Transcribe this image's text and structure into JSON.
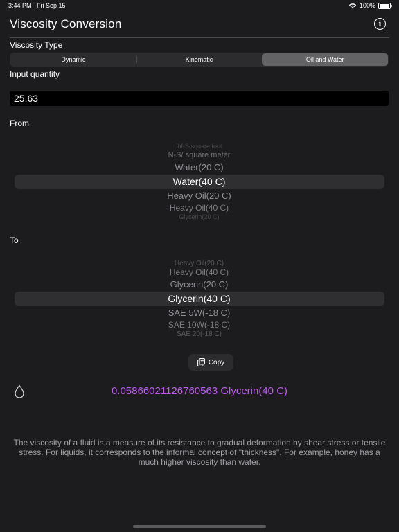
{
  "status_bar": {
    "time": "3:44 PM",
    "date": "Fri Sep 15",
    "battery": "100%",
    "wifi_icon": "wifi-icon",
    "battery_icon": "battery-icon"
  },
  "nav": {
    "title": "Viscosity Conversion",
    "info_icon": "info-icon"
  },
  "viscosity_type": {
    "label": "Viscosity Type",
    "segments": [
      "Dynamic",
      "Kinematic",
      "Oil and Water"
    ],
    "selected": "Oil and Water"
  },
  "input": {
    "label": "Input quantity",
    "value": "25.63"
  },
  "from": {
    "label": "From",
    "items": [
      "lbf-S/square foot",
      "N-S/ square meter",
      "Water(20 C)",
      "Water(40 C)",
      "Heavy Oil(20 C)",
      "Heavy Oil(40 C)",
      "Glycerin(20 C)"
    ],
    "selected": "Water(40 C)"
  },
  "to": {
    "label": "To",
    "items": [
      "Heavy Oil(20 C)",
      "Heavy Oil(40 C)",
      "Glycerin(20 C)",
      "Glycerin(40 C)",
      "SAE 5W(-18 C)",
      "SAE 10W(-18 C)",
      "SAE 20(-18 C)"
    ],
    "selected": "Glycerin(40 C)"
  },
  "copy": {
    "label": "Copy",
    "icon": "copy-icon"
  },
  "result": {
    "text": "0.05866021126760563 Glycerin(40 C)",
    "icon": "drop-icon",
    "color": "#bf5af2"
  },
  "description": "The viscosity of a fluid is a measure of its resistance to gradual deformation by shear stress or tensile stress. For liquids, it corresponds to the informal concept of \"thickness\". For example, honey has a much higher viscosity than water."
}
